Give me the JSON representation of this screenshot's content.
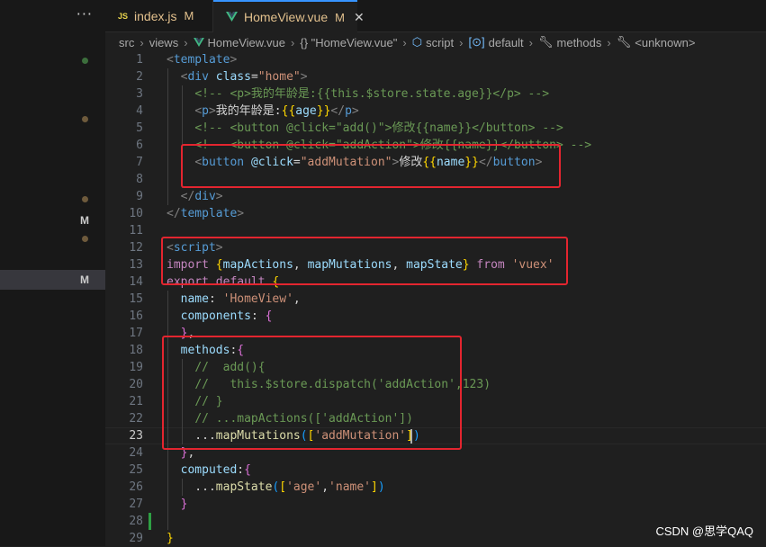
{
  "explorer": {
    "more_label": "···",
    "marks": [
      "M",
      "M"
    ]
  },
  "tabs": [
    {
      "icon": "js",
      "label": "index.js",
      "status": "M"
    },
    {
      "icon": "vue",
      "label": "HomeView.vue",
      "status": "M",
      "close": "✕"
    }
  ],
  "breadcrumb": [
    "src",
    "views",
    "HomeView.vue",
    "{} \"HomeView.vue\"",
    "script",
    "default",
    "methods",
    "<unknown>"
  ],
  "line_numbers": [
    "1",
    "2",
    "3",
    "4",
    "5",
    "6",
    "7",
    "8",
    "9",
    "10",
    "11",
    "12",
    "13",
    "14",
    "15",
    "16",
    "17",
    "18",
    "19",
    "20",
    "21",
    "22",
    "23",
    "24",
    "25",
    "26",
    "27",
    "28",
    "29"
  ],
  "active_line": "23",
  "code": [
    [
      [
        "t-tag",
        "<"
      ],
      [
        "t-name",
        "template"
      ],
      [
        "t-tag",
        ">"
      ]
    ],
    [
      [
        "t-txt",
        "  "
      ],
      [
        "t-tag",
        "<"
      ],
      [
        "t-name",
        "div"
      ],
      [
        "t-txt",
        " "
      ],
      [
        "t-attr",
        "class"
      ],
      [
        "t-txt",
        "="
      ],
      [
        "t-str",
        "\"home\""
      ],
      [
        "t-tag",
        ">"
      ]
    ],
    [
      [
        "t-txt",
        "    "
      ],
      [
        "t-cmt",
        "<!-- <p>我的年龄是:{{this.$store.state.age}}</p> -->"
      ]
    ],
    [
      [
        "t-txt",
        "    "
      ],
      [
        "t-tag",
        "<"
      ],
      [
        "t-name",
        "p"
      ],
      [
        "t-tag",
        ">"
      ],
      [
        "t-txt",
        "我的年龄是:"
      ],
      [
        "t-b1",
        "{{"
      ],
      [
        "t-key",
        "age"
      ],
      [
        "t-b1",
        "}}"
      ],
      [
        "t-tag",
        "</"
      ],
      [
        "t-name",
        "p"
      ],
      [
        "t-tag",
        ">"
      ]
    ],
    [
      [
        "t-txt",
        "    "
      ],
      [
        "t-cmt",
        "<!-- <button @click=\"add()\">修改{{name}}</button> -->"
      ]
    ],
    [
      [
        "t-txt",
        "    "
      ],
      [
        "t-cmt",
        "<!-- <button @click=\"addAction\">修改{{name}}</button> -->"
      ]
    ],
    [
      [
        "t-txt",
        "    "
      ],
      [
        "t-tag",
        "<"
      ],
      [
        "t-name",
        "button"
      ],
      [
        "t-txt",
        " "
      ],
      [
        "t-attr",
        "@click"
      ],
      [
        "t-txt",
        "="
      ],
      [
        "t-str",
        "\"addMutation\""
      ],
      [
        "t-tag",
        ">"
      ],
      [
        "t-txt",
        "修改"
      ],
      [
        "t-b1",
        "{{"
      ],
      [
        "t-key",
        "name"
      ],
      [
        "t-b1",
        "}}"
      ],
      [
        "t-tag",
        "</"
      ],
      [
        "t-name",
        "button"
      ],
      [
        "t-tag",
        ">"
      ]
    ],
    [],
    [
      [
        "t-txt",
        "  "
      ],
      [
        "t-tag",
        "</"
      ],
      [
        "t-name",
        "div"
      ],
      [
        "t-tag",
        ">"
      ]
    ],
    [
      [
        "t-tag",
        "</"
      ],
      [
        "t-name",
        "template"
      ],
      [
        "t-tag",
        ">"
      ]
    ],
    [],
    [
      [
        "t-tag",
        "<"
      ],
      [
        "t-name",
        "script"
      ],
      [
        "t-tag",
        ">"
      ]
    ],
    [
      [
        "t-kw",
        "import"
      ],
      [
        "t-txt",
        " "
      ],
      [
        "t-b1",
        "{"
      ],
      [
        "t-key",
        "mapActions"
      ],
      [
        "t-txt",
        ", "
      ],
      [
        "t-key",
        "mapMutations"
      ],
      [
        "t-txt",
        ", "
      ],
      [
        "t-key",
        "mapState"
      ],
      [
        "t-b1",
        "}"
      ],
      [
        "t-txt",
        " "
      ],
      [
        "t-kw",
        "from"
      ],
      [
        "t-txt",
        " "
      ],
      [
        "t-str",
        "'vuex'"
      ]
    ],
    [
      [
        "t-kw",
        "export"
      ],
      [
        "t-txt",
        " "
      ],
      [
        "t-kw",
        "default"
      ],
      [
        "t-txt",
        " "
      ],
      [
        "t-b1",
        "{"
      ]
    ],
    [
      [
        "t-txt",
        "  "
      ],
      [
        "t-key",
        "name"
      ],
      [
        "t-txt",
        ": "
      ],
      [
        "t-str",
        "'HomeView'"
      ],
      [
        "t-txt",
        ","
      ]
    ],
    [
      [
        "t-txt",
        "  "
      ],
      [
        "t-key",
        "components"
      ],
      [
        "t-txt",
        ": "
      ],
      [
        "t-b2",
        "{"
      ]
    ],
    [
      [
        "t-txt",
        "  "
      ],
      [
        "t-b2",
        "}"
      ],
      [
        "t-txt",
        ","
      ]
    ],
    [
      [
        "t-txt",
        "  "
      ],
      [
        "t-key",
        "methods"
      ],
      [
        "t-txt",
        ":"
      ],
      [
        "t-b2",
        "{"
      ]
    ],
    [
      [
        "t-txt",
        "    "
      ],
      [
        "t-cmt",
        "//  add(){"
      ]
    ],
    [
      [
        "t-txt",
        "    "
      ],
      [
        "t-cmt",
        "//   this.$store.dispatch('addAction',123)"
      ]
    ],
    [
      [
        "t-txt",
        "    "
      ],
      [
        "t-cmt",
        "// }"
      ]
    ],
    [
      [
        "t-txt",
        "    "
      ],
      [
        "t-cmt",
        "// ...mapActions(['addAction'])"
      ]
    ],
    [
      [
        "t-txt",
        "    ..."
      ],
      [
        "t-fn",
        "mapMutations"
      ],
      [
        "t-b3",
        "("
      ],
      [
        "t-b1",
        "["
      ],
      [
        "t-str",
        "'addMutation'"
      ],
      [
        "t-b1",
        "]"
      ],
      [
        "t-b3",
        ")"
      ]
    ],
    [
      [
        "t-txt",
        "  "
      ],
      [
        "t-b2",
        "}"
      ],
      [
        "t-txt",
        ","
      ]
    ],
    [
      [
        "t-txt",
        "  "
      ],
      [
        "t-key",
        "computed"
      ],
      [
        "t-txt",
        ":"
      ],
      [
        "t-b2",
        "{"
      ]
    ],
    [
      [
        "t-txt",
        "    ..."
      ],
      [
        "t-fn",
        "mapState"
      ],
      [
        "t-b3",
        "("
      ],
      [
        "t-b1",
        "["
      ],
      [
        "t-str",
        "'age'"
      ],
      [
        "t-txt",
        ","
      ],
      [
        "t-str",
        "'name'"
      ],
      [
        "t-b1",
        "]"
      ],
      [
        "t-b3",
        ")"
      ]
    ],
    [
      [
        "t-txt",
        "  "
      ],
      [
        "t-b2",
        "}"
      ]
    ],
    [],
    [
      [
        "t-b1",
        "}"
      ]
    ]
  ],
  "watermark": "CSDN @思学QAQ"
}
